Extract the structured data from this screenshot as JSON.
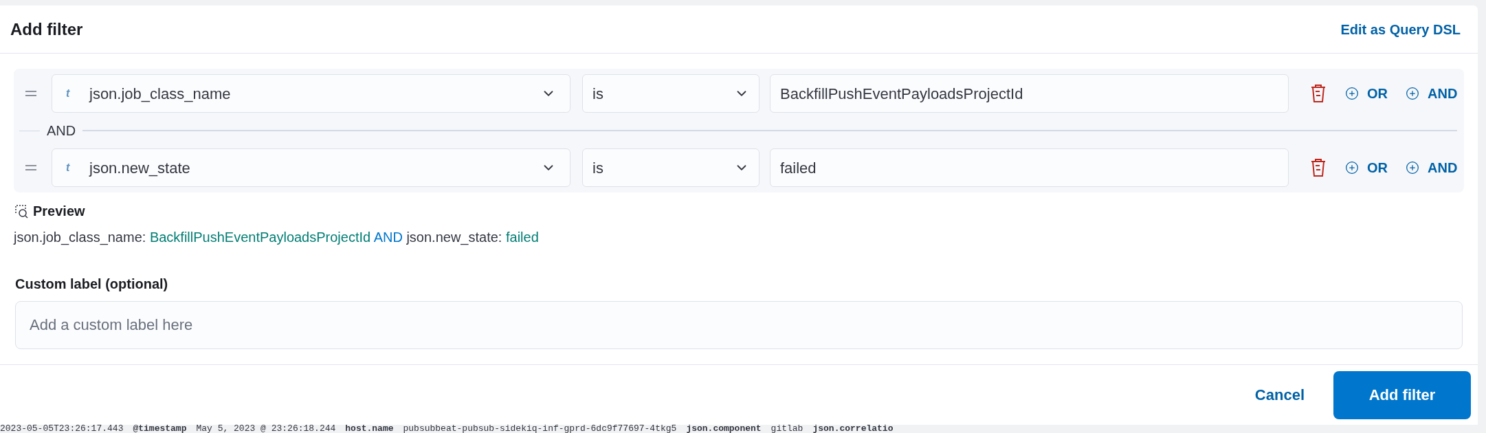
{
  "modal": {
    "title": "Add filter",
    "edit_link": "Edit as Query DSL",
    "rules": [
      {
        "field_type": "t",
        "field": "json.job_class_name",
        "operator": "is",
        "value": "BackfillPushEventPayloadsProjectId",
        "or_label": "OR",
        "and_label": "AND"
      },
      {
        "field_type": "t",
        "field": "json.new_state",
        "operator": "is",
        "value": "failed",
        "or_label": "OR",
        "and_label": "AND"
      }
    ],
    "separator": "AND",
    "preview": {
      "title": "Preview",
      "parts": [
        {
          "kind": "field",
          "text": "json.job_class_name: "
        },
        {
          "kind": "value",
          "text": "BackfillPushEventPayloadsProjectId"
        },
        {
          "kind": "conjunction",
          "text": " AND "
        },
        {
          "kind": "field",
          "text": "json.new_state: "
        },
        {
          "kind": "value",
          "text": "failed"
        }
      ]
    },
    "custom_label": {
      "label": "Custom label (optional)",
      "placeholder": "Add a custom label here"
    },
    "buttons": {
      "cancel": "Cancel",
      "submit": "Add filter"
    }
  },
  "background_row": [
    {
      "kind": "plain",
      "text": "2023-05-05T23:26:17.443"
    },
    {
      "kind": "key",
      "text": "@timestamp"
    },
    {
      "kind": "plain",
      "text": "May 5, 2023 @ 23:26:18.244"
    },
    {
      "kind": "key",
      "text": "host.name"
    },
    {
      "kind": "plain",
      "text": "pubsubbeat-pubsub-sidekiq-inf-gprd-6dc9f77697-4tkg5"
    },
    {
      "kind": "key",
      "text": "json.component"
    },
    {
      "kind": "plain",
      "text": "gitlab"
    },
    {
      "kind": "key",
      "text": "json.correlatio"
    }
  ]
}
